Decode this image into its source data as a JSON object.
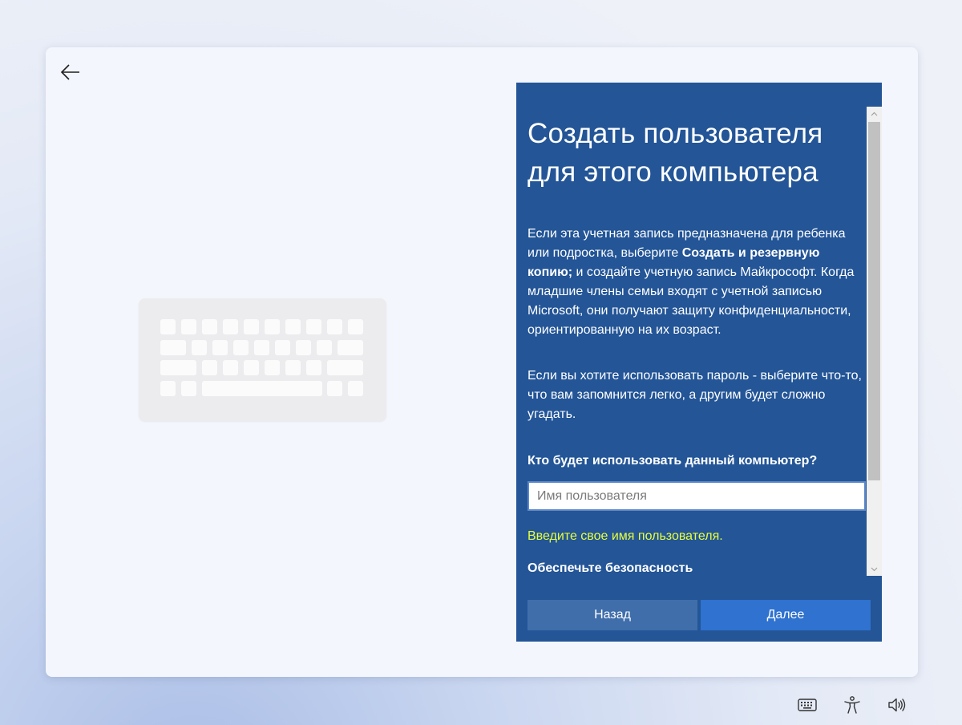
{
  "window": {
    "panel": {
      "title_line1": "Создать пользователя",
      "title_line2": "для этого компьютера",
      "para1_part1": "Если эта учетная запись предназначена для ребенка или подростка, выберите ",
      "para1_bold": "Создать и резервную копию;",
      "para1_part2": " и создайте учетную запись Майкрософт. Когда младшие члены семьи входят с учетной записью Microsoft, они получают защиту конфиденциальности, ориентированную на их возраст.",
      "para2": "Если вы хотите использовать пароль - выберите что-то, что вам запомнится легко, а другим будет сложно угадать.",
      "question": "Кто будет использовать данный компьютер?",
      "username_placeholder": "Имя пользователя",
      "username_value": "",
      "hint": "Введите свое имя пользователя.",
      "next_section": "Обеспечьте безопасность"
    },
    "buttons": {
      "back_label": "Назад",
      "next_label": "Далее"
    }
  },
  "icons": {
    "back": "arrow-left-icon",
    "illustration": "keyboard-illustration",
    "tray": [
      "keyboard-icon",
      "accessibility-icon",
      "volume-icon"
    ]
  },
  "colors": {
    "panel_bg": "#235597",
    "hint_text": "#e8ff3a",
    "back_button": "#3f6eab",
    "next_button": "#2f72cf"
  }
}
